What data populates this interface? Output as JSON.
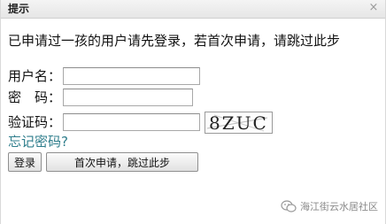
{
  "dialog": {
    "title": "提示",
    "close_glyph": "×",
    "message": "已申请过一孩的用户请先登录，若首次申请，请跳过此步"
  },
  "form": {
    "username_label": "用户名：",
    "username_value": "",
    "password_label": "密　码：",
    "password_value": "",
    "captcha_label": "验证码：",
    "captcha_value": "",
    "captcha_image_text": "8ZUC",
    "forgot_password": "忘记密码?"
  },
  "buttons": {
    "login": "登录",
    "skip": "首次申请，跳过此步"
  },
  "watermark": {
    "text": "海江街云水居社区",
    "icon": "wechat-icon"
  }
}
